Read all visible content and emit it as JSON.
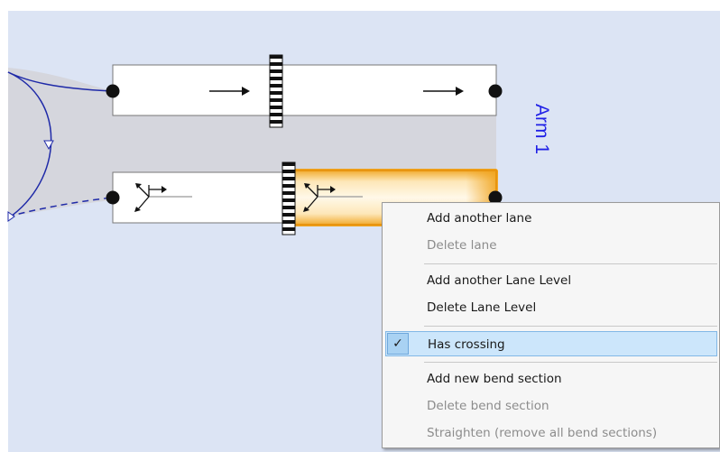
{
  "arm": {
    "label": "Arm 1"
  },
  "context_menu": {
    "items": [
      {
        "label": "Add another lane",
        "enabled": true,
        "checked": false
      },
      {
        "label": "Delete lane",
        "enabled": false,
        "checked": false
      },
      {
        "label": "Add another Lane Level",
        "enabled": true,
        "checked": false
      },
      {
        "label": "Delete Lane Level",
        "enabled": true,
        "checked": false
      },
      {
        "label": "Has crossing",
        "enabled": true,
        "checked": true
      },
      {
        "label": "Add new bend section",
        "enabled": true,
        "checked": false
      },
      {
        "label": "Delete bend section",
        "enabled": false,
        "checked": false
      },
      {
        "label": "Straighten (remove all bend sections)",
        "enabled": false,
        "checked": false
      }
    ],
    "check_glyph": "✓"
  },
  "lanes": [
    {
      "name": "top-lane",
      "direction": "straight",
      "highlighted": false
    },
    {
      "name": "bottom-lane",
      "direction": "left-straight-right",
      "highlighted": true
    }
  ],
  "colors": {
    "highlight": "#f5a81e",
    "arm_label": "#1f1fe6",
    "connector": "#1f2aa8"
  }
}
